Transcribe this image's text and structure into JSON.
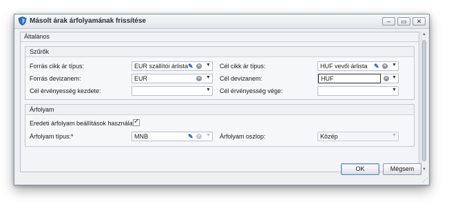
{
  "window": {
    "title": "Másolt árak árfolyamának frissítése",
    "controls": {
      "minimize": "‒",
      "maximize": "▭",
      "close": "✕"
    }
  },
  "general": {
    "header": "Általános",
    "filters": {
      "header": "Szűrők",
      "source_price_type": {
        "label": "Forrás cikk ár típus:",
        "value": "EUR szállítói árlista"
      },
      "target_price_type": {
        "label": "Cél cikk ár típus:",
        "value": "HUF vevői árlista"
      },
      "source_currency": {
        "label": "Forrás devizanem:",
        "value": "EUR"
      },
      "target_currency": {
        "label": "Cél devizanem:",
        "value": "HUF"
      },
      "validity_start": {
        "label": "Cél érvényesség kezdete:",
        "value": ""
      },
      "validity_end": {
        "label": "Cél érvényesség vége:",
        "value": ""
      }
    },
    "rate": {
      "header": "Árfolyam",
      "use_original": {
        "label": "Eredeti árfolyam beállítások használata",
        "checked": true
      },
      "rate_type": {
        "label": "Árfolyam típus:*",
        "value": "MNB"
      },
      "rate_column": {
        "label": "Árfolyam oszlop:",
        "value": "Közép"
      }
    }
  },
  "buttons": {
    "ok": "OK",
    "cancel": "Mégsem"
  },
  "icons": {
    "app": "shield-icon",
    "edit": "pencil-icon",
    "clear": "clear-icon",
    "dropdown": "chevron-down-icon",
    "check": "checkmark-icon"
  },
  "colors": {
    "accent": "#1f5fb5",
    "pencil": "#1f5fb5"
  }
}
